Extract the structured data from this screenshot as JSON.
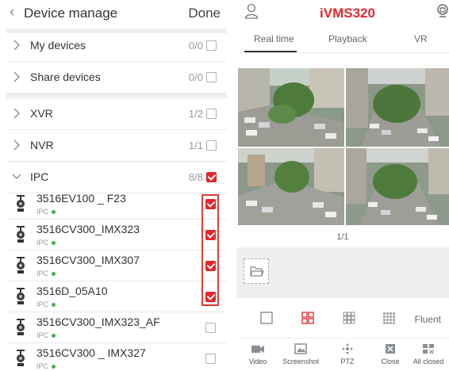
{
  "device_manage": {
    "title": "Device manage",
    "done_label": "Done",
    "groups_top": [
      {
        "name": "My devices",
        "count": "0/0",
        "checked": false
      },
      {
        "name": "Share devices",
        "count": "0/0",
        "checked": false
      }
    ],
    "groups_mid": [
      {
        "name": "XVR",
        "count": "1/2",
        "checked": false
      },
      {
        "name": "NVR",
        "count": "1/1",
        "checked": false
      },
      {
        "name": "IPC",
        "count": "8/8",
        "checked": true
      }
    ],
    "devices": [
      {
        "name": "3516EV100 _ F23",
        "type": "IPC",
        "checked": true
      },
      {
        "name": "3516CV300_IMX323",
        "type": "IPC",
        "checked": true
      },
      {
        "name": "3516CV300_IMX307",
        "type": "IPC",
        "checked": true
      },
      {
        "name": "3516D_05A10",
        "type": "IPC",
        "checked": true
      },
      {
        "name": "3516CV300_IMX323_AF",
        "type": "IPC",
        "checked": false
      },
      {
        "name": "3516CV300 _ IMX327",
        "type": "IPC",
        "checked": false
      }
    ]
  },
  "app": {
    "brand": "iVMS320",
    "tabs": [
      "Real time",
      "Playback",
      "VR"
    ],
    "pager": "1/1",
    "quality_label": "Fluent",
    "bottom_bar": [
      "Video",
      "Screenshot",
      "PTZ",
      "Close",
      "All closed"
    ]
  },
  "colors": {
    "accent": "#e5262b",
    "online": "#4caf50"
  }
}
